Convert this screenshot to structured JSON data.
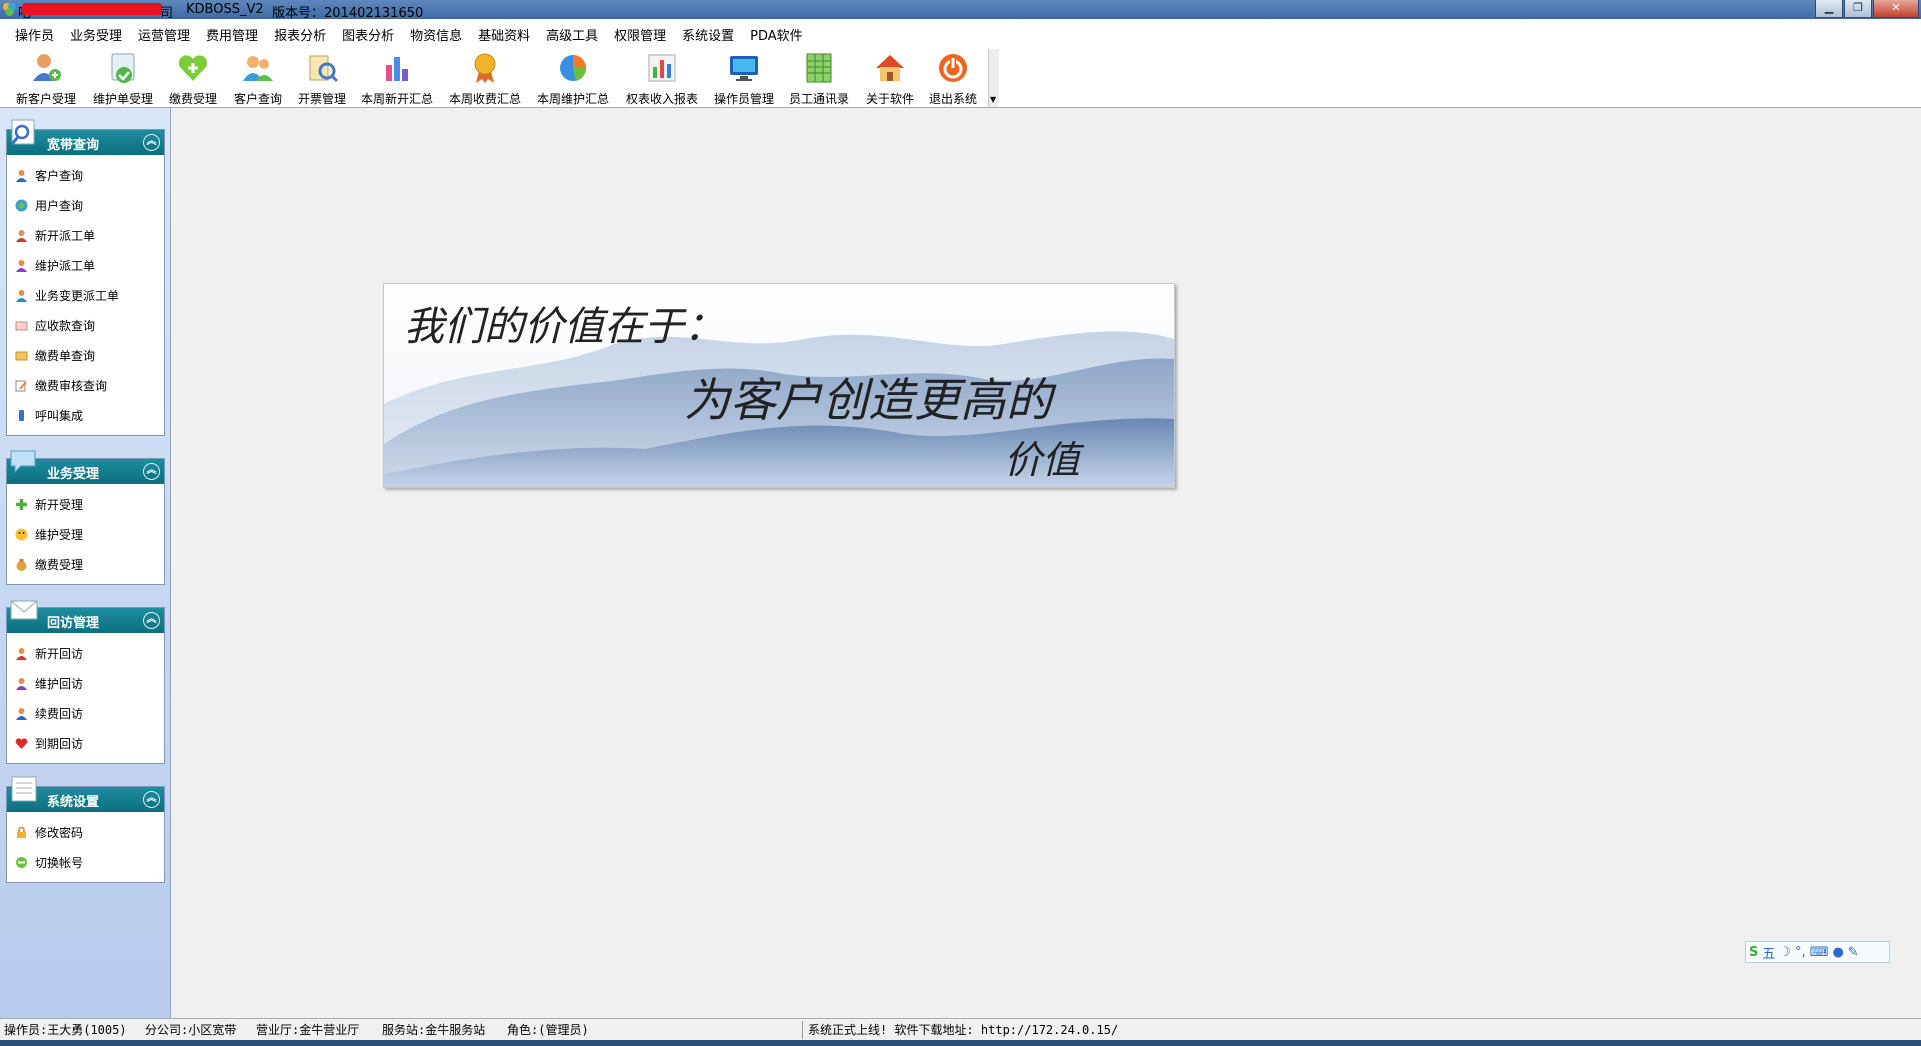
{
  "window": {
    "app_name": "KDBOSS_V2",
    "version_text": "版本号：201402131650",
    "title_suffix": "司",
    "title_prefix": "吧"
  },
  "menu": [
    "操作员",
    "业务受理",
    "运营管理",
    "费用管理",
    "报表分析",
    "图表分析",
    "物资信息",
    "基础资料",
    "高级工具",
    "权限管理",
    "系统设置",
    "PDA软件"
  ],
  "toolbar": [
    {
      "label": "新客户受理",
      "icon": "user-add-icon"
    },
    {
      "label": "维护单受理",
      "icon": "document-check-icon"
    },
    {
      "label": "缴费受理",
      "icon": "heart-plus-icon"
    },
    {
      "label": "客户查询",
      "icon": "users-icon"
    },
    {
      "label": "开票管理",
      "icon": "invoice-search-icon"
    },
    {
      "label": "本周新开汇总",
      "icon": "bar-chart-icon"
    },
    {
      "label": "本周收费汇总",
      "icon": "award-icon"
    },
    {
      "label": "本周维护汇总",
      "icon": "pie-chart-icon"
    },
    {
      "label": "权表收入报表",
      "icon": "report-chart-icon"
    },
    {
      "label": "操作员管理",
      "icon": "monitor-icon"
    },
    {
      "label": "员工通讯录",
      "icon": "spreadsheet-icon"
    },
    {
      "label": "关于软件",
      "icon": "home-icon"
    },
    {
      "label": "退出系统",
      "icon": "power-icon"
    }
  ],
  "sidebar": {
    "groups": [
      {
        "title": "宽带查询",
        "items": [
          "客户查询",
          "用户查询",
          "新开派工单",
          "维护派工单",
          "业务变更派工单",
          "应收款查询",
          "缴费单查询",
          "缴费审核查询",
          "呼叫集成"
        ]
      },
      {
        "title": "业务受理",
        "items": [
          "新开受理",
          "维护受理",
          "缴费受理"
        ]
      },
      {
        "title": "回访管理",
        "items": [
          "新开回访",
          "维护回访",
          "续费回访",
          "到期回访"
        ]
      },
      {
        "title": "系统设置",
        "items": [
          "修改密码",
          "切换帐号"
        ]
      }
    ]
  },
  "banner": {
    "line1": "我们的价值在于：",
    "line2": "为客户创造更高的",
    "line3": "价值"
  },
  "ime": {
    "mode_char": "五"
  },
  "status": {
    "operator": "操作员:王大勇(1005)",
    "branch": "分公司:小区宽带",
    "hall": "营业厅:金牛营业厅",
    "station": "服务站:金牛服务站",
    "role": "角色:(管理员)",
    "notice": "系统正式上线!  软件下载地址:  http://172.24.0.15/"
  },
  "colors": {
    "titlebar": "#4a77b0",
    "group_header": "#12808f",
    "sidebar_bg": "#c9d9f2",
    "redaction": "#e8141c"
  }
}
